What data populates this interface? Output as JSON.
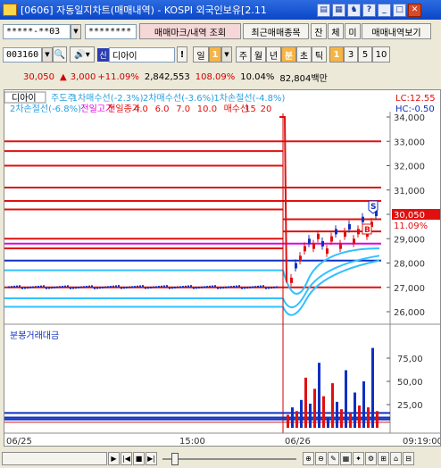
{
  "window": {
    "title": "[0606] 자동일지차트(매매내역) - KOSPI 외국인보유[2.11"
  },
  "toolbar1": {
    "account": "*****-**03",
    "password": "********",
    "btn_trade_mark": "매매마크/내역 조회",
    "btn_recent": "최근매매종목",
    "btn_jan": "잔",
    "btn_che": "체",
    "btn_mi": "미",
    "btn_view": "매매내역보기"
  },
  "toolbar2": {
    "code": "003160",
    "badge": "신",
    "name": "디아이",
    "period_day": "일",
    "period_value": "1",
    "btn_week": "주",
    "btn_month": "월",
    "btn_year": "년",
    "btn_min": "분",
    "btn_sec": "초",
    "btn_tick": "틱",
    "n1": "1",
    "n2": "3",
    "n3": "5",
    "n4": "10"
  },
  "pricebar": {
    "price": "30,050",
    "arrow": "▲",
    "change": "3,000",
    "pct": "+11.09%",
    "volume": "2,842,553",
    "vol_ratio": "108.09%",
    "turnover": "10.04%",
    "amount": "82,804백만"
  },
  "chart": {
    "tab": "디아이",
    "legend1": [
      {
        "text": "주도주",
        "color": "#2aa0e0"
      },
      {
        "text": "1차매수선(-2.3%)",
        "color": "#2aa0e0"
      },
      {
        "text": "2차매수선(-3.6%)",
        "color": "#2aa0e0"
      },
      {
        "text": "1차손절선(-4.8%)",
        "color": "#2aa0e0"
      }
    ],
    "legend2": [
      {
        "text": "2차손절선(-6.8%)",
        "color": "#2aa0e0"
      },
      {
        "text": "전일고가",
        "color": "#e000e0"
      },
      {
        "text": "전일종가",
        "color": "#e01010"
      },
      {
        "text": "4.0",
        "color": "#e01010"
      },
      {
        "text": "6.0",
        "color": "#e01010"
      },
      {
        "text": "7.0",
        "color": "#e01010"
      },
      {
        "text": "10.0",
        "color": "#e01010"
      },
      {
        "text": "매수선",
        "color": "#e01010"
      },
      {
        "text": "15",
        "color": "#e01010"
      },
      {
        "text": "20",
        "color": "#e01010"
      }
    ],
    "lc": "LC:12.55",
    "hc": "HC:-0.50",
    "current_price_tag": "30,050",
    "pct_tag": "11.09%",
    "marker_s": "S",
    "marker_b": "B",
    "y_ticks": [
      "34,000",
      "33,000",
      "32,000",
      "31,000",
      "30,000",
      "29,000",
      "28,000",
      "27,000",
      "26,000"
    ],
    "vol_title": "분봉거래대금",
    "vol_ticks": [
      "75,00",
      "50,00",
      "25,00"
    ],
    "x_labels": [
      "06/25",
      "15:00",
      "06/26",
      "09:19:00"
    ]
  },
  "bottom": {
    "nav": [
      "|◀",
      "◀",
      "■",
      "▶|",
      "◀|",
      "▶"
    ]
  }
}
